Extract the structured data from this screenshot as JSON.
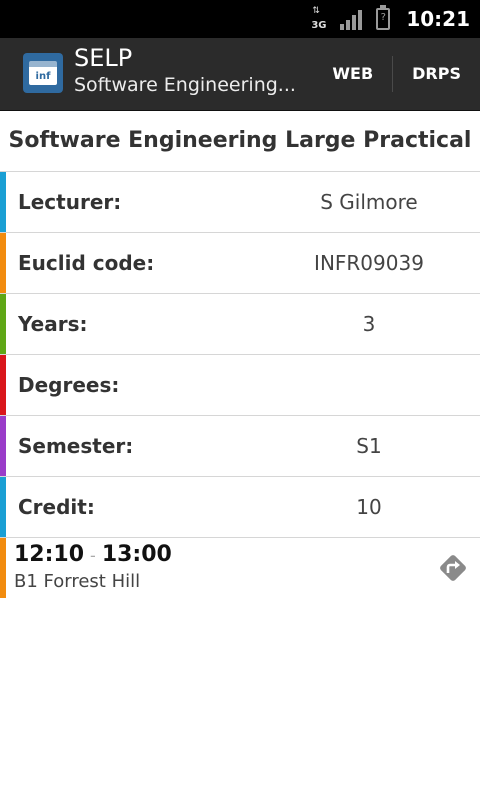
{
  "status_bar": {
    "network": "3G",
    "battery_icon": "?",
    "time": "10:21"
  },
  "action_bar": {
    "app_title": "SELP",
    "subtitle": "Software Engineering...",
    "icon_text": "inf",
    "actions": [
      "WEB",
      "DRPS"
    ]
  },
  "course": {
    "title": "Software Engineering Large Practical"
  },
  "details": [
    {
      "label": "Lecturer:",
      "value": "S Gilmore",
      "color": "#1a9fd4"
    },
    {
      "label": "Euclid code:",
      "value": "INFR09039",
      "color": "#f28c0f"
    },
    {
      "label": "Years:",
      "value": "3",
      "color": "#5fa716"
    },
    {
      "label": "Degrees:",
      "value": "",
      "color": "#d9161b"
    },
    {
      "label": "Semester:",
      "value": "S1",
      "color": "#9a3cc9"
    },
    {
      "label": "Credit:",
      "value": "10",
      "color": "#1a9fd4"
    }
  ],
  "slot": {
    "start": "12:10",
    "separator": "-",
    "end": "13:00",
    "location": "B1 Forrest Hill",
    "color": "#f28c0f"
  }
}
